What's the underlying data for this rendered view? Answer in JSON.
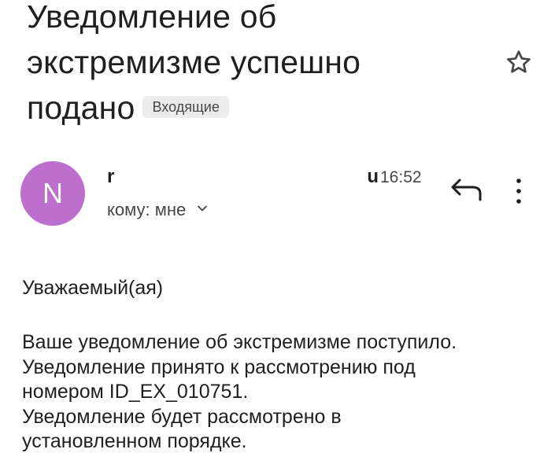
{
  "email": {
    "subject_lines": [
      "Уведомление об",
      "экстремизме успешно",
      "подано"
    ],
    "label": "Входящие",
    "sender": {
      "avatar_letter": "N",
      "avatar_color": "#bc6fcd",
      "name_start": "r",
      "name_end": "u",
      "time": "16:52",
      "recipient": "кому: мне"
    },
    "greeting": "Уважаемый(ая)",
    "body_lines": [
      "Ваше уведомление об экстремизме поступило.",
      "Уведомление принято к рассмотрению под",
      "номером ID_EX_010751.",
      "Уведомление будет рассмотрено в",
      "установленном порядке."
    ]
  },
  "icons": {
    "star": "star-outline-icon",
    "reply": "reply-icon",
    "more": "more-vertical-icon",
    "expand": "chevron-down-icon"
  }
}
